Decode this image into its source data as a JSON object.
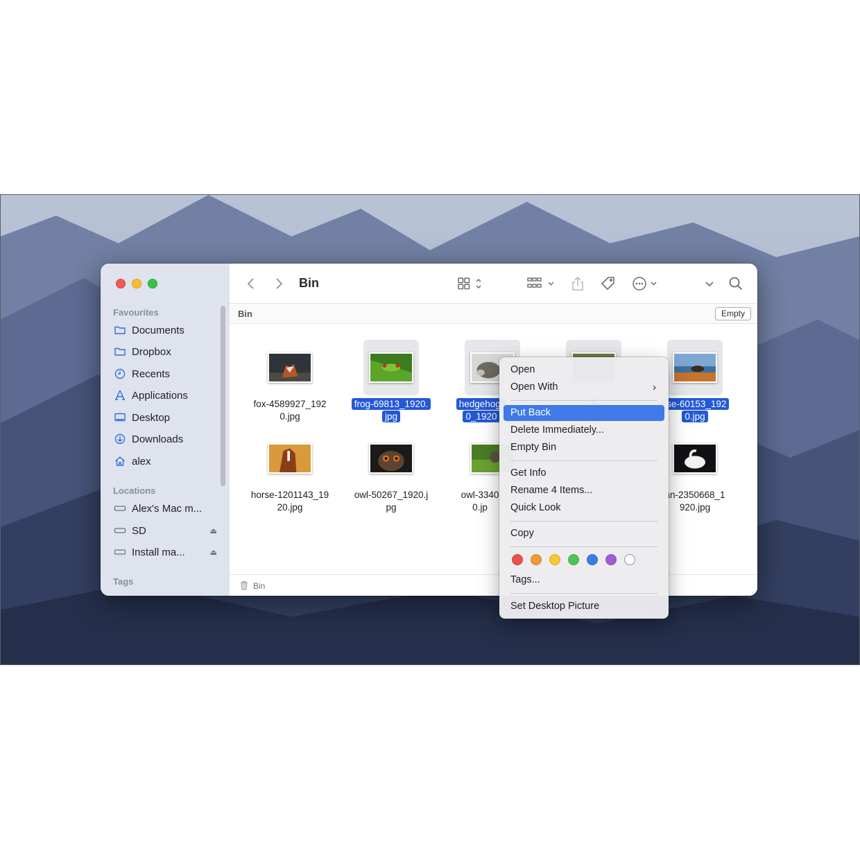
{
  "window": {
    "title": "Bin"
  },
  "sidebar": {
    "favourites_label": "Favourites",
    "favourites": [
      {
        "label": "Documents",
        "icon": "folder-icon"
      },
      {
        "label": "Dropbox",
        "icon": "folder-icon"
      },
      {
        "label": "Recents",
        "icon": "clock-icon"
      },
      {
        "label": "Applications",
        "icon": "applications-icon"
      },
      {
        "label": "Desktop",
        "icon": "desktop-icon"
      },
      {
        "label": "Downloads",
        "icon": "download-icon"
      },
      {
        "label": "alex",
        "icon": "home-icon"
      }
    ],
    "locations_label": "Locations",
    "locations": [
      {
        "label": "Alex's Mac m...",
        "icon": "drive-icon"
      },
      {
        "label": "SD",
        "icon": "drive-icon",
        "ejectable": true
      },
      {
        "label": "Install ma...",
        "icon": "drive-icon",
        "ejectable": true
      }
    ],
    "tags_label": "Tags"
  },
  "pathbar": {
    "label": "Bin",
    "empty_button": "Empty"
  },
  "files": [
    {
      "line1": "fox-4589927_192",
      "line2": "0.jpg",
      "selected": false
    },
    {
      "line1": "frog-69813_1920.",
      "line2": "jpg",
      "selected": true
    },
    {
      "line1": "hedgehog-",
      "line2": "0_1920",
      "selected": true
    },
    {
      "line1": "",
      "line2": "",
      "selected": true
    },
    {
      "line1": "rse-60153_192",
      "line2": "0.jpg",
      "selected": true
    },
    {
      "line1": "horse-1201143_19",
      "line2": "20.jpg",
      "selected": false
    },
    {
      "line1": "owl-50267_1920.j",
      "line2": "pg",
      "selected": false
    },
    {
      "line1": "owl-3340",
      "line2": "0.jp",
      "selected": false
    },
    {
      "line1": "an-2350668_1",
      "line2": "920.jpg",
      "selected": false
    }
  ],
  "statusbar": {
    "label": "Bin"
  },
  "context_menu": {
    "open": "Open",
    "open_with": "Open With",
    "put_back": "Put Back",
    "delete_immediately": "Delete Immediately...",
    "empty_bin": "Empty Bin",
    "get_info": "Get Info",
    "rename": "Rename 4 Items...",
    "quick_look": "Quick Look",
    "copy": "Copy",
    "tags": "Tags...",
    "set_desktop": "Set Desktop Picture",
    "tag_colors": [
      "#e5534b",
      "#f09a37",
      "#f5c932",
      "#4fc455",
      "#3f7ae6",
      "#a35bd6",
      "#ffffff"
    ]
  }
}
